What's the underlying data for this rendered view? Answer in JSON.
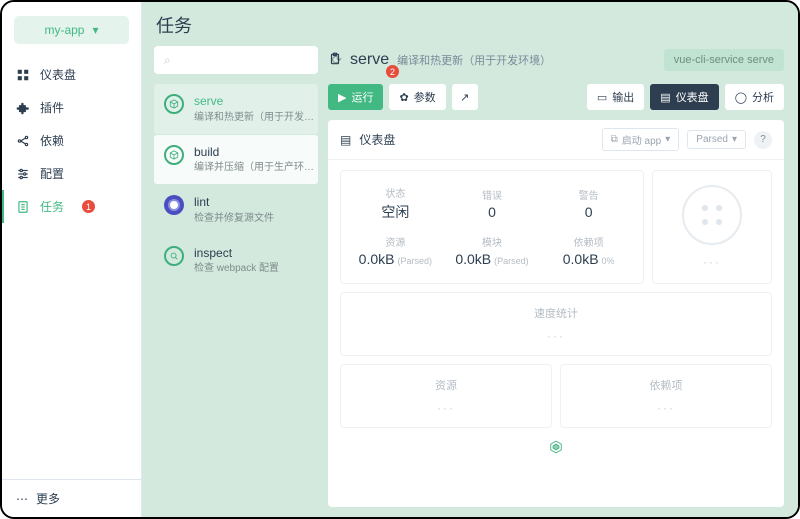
{
  "project": {
    "name": "my-app"
  },
  "nav": {
    "dashboard": "仪表盘",
    "plugins": "插件",
    "deps": "依赖",
    "config": "配置",
    "tasks": "任务",
    "tasks_badge": "1",
    "more": "更多"
  },
  "page": {
    "title": "任务"
  },
  "search": {
    "placeholder": ""
  },
  "tasks": {
    "serve": {
      "name": "serve",
      "desc": "编译和热更新（用于开发环…"
    },
    "build": {
      "name": "build",
      "desc": "编译并压缩（用于生产环境…"
    },
    "lint": {
      "name": "lint",
      "desc": "检查并修复源文件"
    },
    "inspect": {
      "name": "inspect",
      "desc": "检查 webpack 配置"
    }
  },
  "detail": {
    "name": "serve",
    "subtitle": "编译和热更新（用于开发环境）",
    "command": "vue-cli-service serve",
    "badge": "2",
    "buttons": {
      "run": "运行",
      "params": "参数",
      "output": "输出",
      "dashboard": "仪表盘",
      "analyze": "分析"
    }
  },
  "panel": {
    "title": "仪表盘",
    "open_app": "启动 app",
    "parsed": "Parsed"
  },
  "stats": {
    "status_lbl": "状态",
    "status_val": "空闲",
    "errors_lbl": "错误",
    "errors_val": "0",
    "warnings_lbl": "警告",
    "warnings_val": "0",
    "assets_lbl": "资源",
    "assets_val": "0.0kB",
    "assets_tag": "(Parsed)",
    "modules_lbl": "模块",
    "modules_val": "0.0kB",
    "modules_tag": "(Parsed)",
    "deps_lbl": "依赖项",
    "deps_val": "0.0kB",
    "deps_tag": "0%"
  },
  "cards": {
    "speed": "速度统计",
    "assets": "资源",
    "deps": "依赖项",
    "placeholder": "···"
  }
}
